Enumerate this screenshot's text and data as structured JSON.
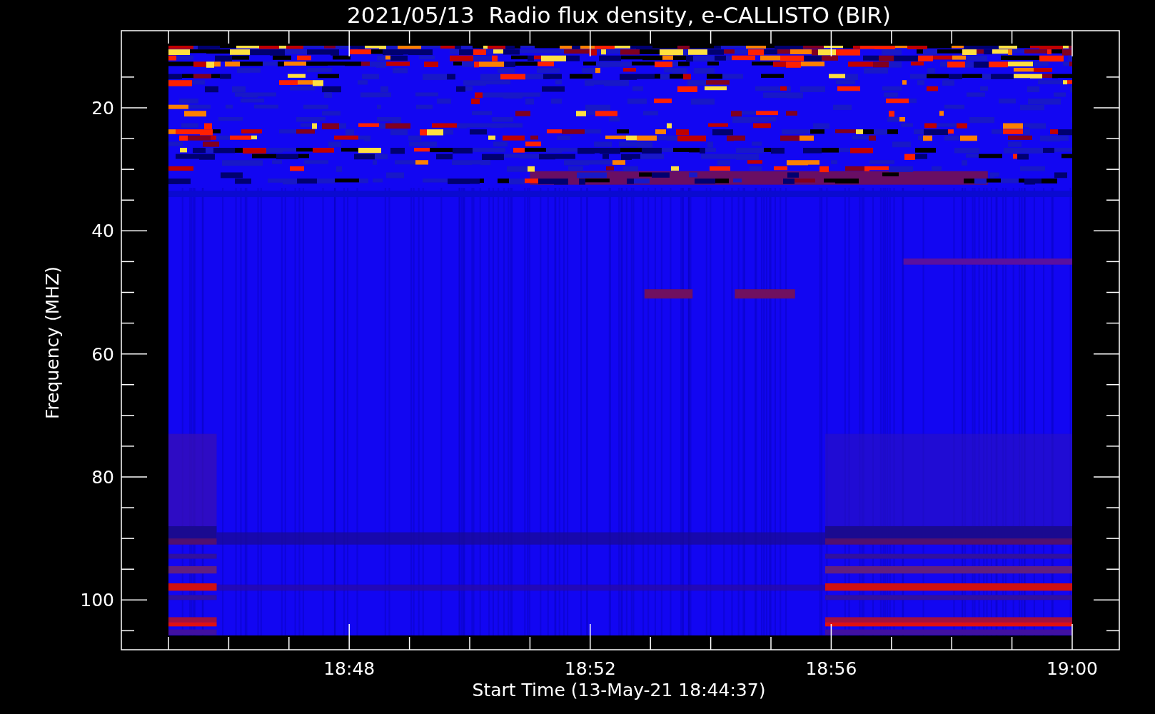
{
  "chart": {
    "title": "2021/05/13  Radio flux density, e-CALLISTO (BIR)",
    "ylabel": "Frequency (MHZ)",
    "xlabel": "Start Time (13-May-21 18:44:37)",
    "ytick_labels": [
      "20",
      "40",
      "60",
      "80",
      "100"
    ],
    "xtick_labels": [
      "18:48",
      "18:52",
      "18:56",
      "19:00"
    ]
  }
}
